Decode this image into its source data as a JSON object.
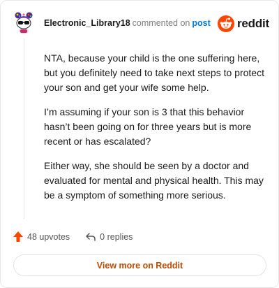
{
  "comment": {
    "username": "Electronic_Library18",
    "commented_text": "commented on",
    "post_link": "post",
    "avatar_icon": "snoo-avatar-icon",
    "paragraphs": [
      "NTA, because your child is the one suffering here, but you definitely need to take next steps to protect your son and get your wife some help.",
      "I’m assuming if your son is 3 that this behavior hasn’t been going on for three years but is more recent or has escalated?",
      "Either way, she should be seen by a doctor and evaluated for mental and physical health. This may be a symptom of something more serious."
    ]
  },
  "brand": {
    "wordmark": "reddit",
    "logo_icon": "reddit-logo-icon",
    "color": "#ff4500"
  },
  "actions": {
    "upvotes": "48 upvotes",
    "upvote_icon": "upvote-arrow-icon",
    "upvote_color": "#ff4500",
    "replies": "0 replies",
    "reply_icon": "reply-arrow-icon"
  },
  "footer": {
    "view_more": "View more on Reddit"
  }
}
